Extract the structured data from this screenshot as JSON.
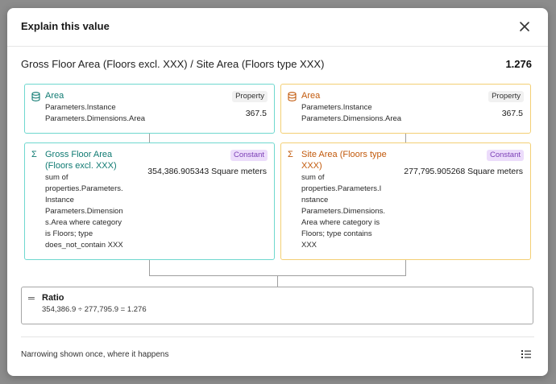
{
  "dialog": {
    "title": "Explain this value",
    "close_icon": "close-icon"
  },
  "expression": {
    "text": "Gross Floor Area (Floors excl. XXX) / Site Area (Floors type XXX)",
    "value": "1.276"
  },
  "left": {
    "property": {
      "icon": "database-icon",
      "title": "Area",
      "subtitle_line1": "Parameters.Instance",
      "subtitle_line2": "Parameters.Dimensions.Area",
      "badge": "Property",
      "value": "367.5"
    },
    "constant": {
      "icon": "sigma-icon",
      "title_line1": "Gross Floor Area",
      "title_line2": "(Floors excl. XXX)",
      "desc_lines": [
        "sum of",
        "properties.Parameters.",
        "Instance",
        "Parameters.Dimension",
        "s.Area where category",
        "is Floors; type",
        "does_not_contain XXX"
      ],
      "badge": "Constant",
      "value": "354,386.905343 Square meters"
    }
  },
  "right": {
    "property": {
      "icon": "database-icon",
      "title": "Area",
      "subtitle_line1": "Parameters.Instance",
      "subtitle_line2": "Parameters.Dimensions.Area",
      "badge": "Property",
      "value": "367.5"
    },
    "constant": {
      "icon": "sigma-icon",
      "title_line1": "Site Area (Floors type",
      "title_line2": "XXX)",
      "desc_lines": [
        "sum of",
        "properties.Parameters.I",
        "nstance",
        "Parameters.Dimensions.",
        "Area where category is",
        "Floors; type contains",
        "XXX"
      ],
      "badge": "Constant",
      "value": "277,795.905268 Square meters"
    }
  },
  "ratio": {
    "icon": "equals-icon",
    "title": "Ratio",
    "formula": "354,386.9 ÷ 277,795.9 = 1.276"
  },
  "footer": {
    "note": "Narrowing shown once, where it happens",
    "list_icon": "list-icon"
  },
  "colors": {
    "teal_border": "#6fd8cf",
    "teal_text": "#0f7a72",
    "amber_border": "#f3cf74",
    "amber_text": "#c25a0c",
    "constant_badge_bg": "#ecdcfb",
    "constant_badge_text": "#7b3fb6"
  }
}
